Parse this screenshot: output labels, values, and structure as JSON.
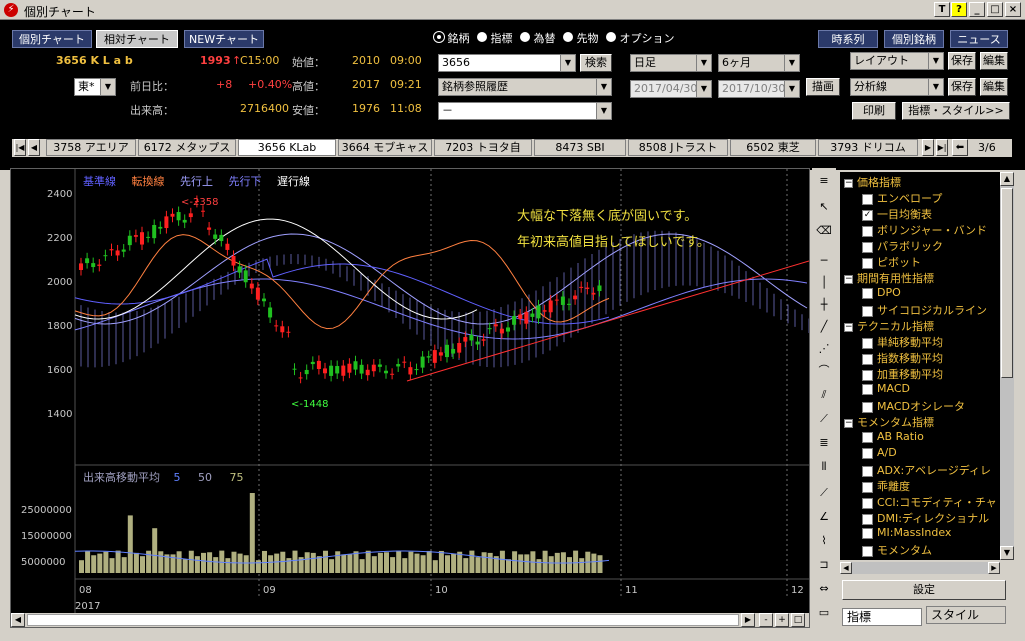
{
  "window": {
    "title": "個別チャート"
  },
  "toolbar": {
    "views": [
      "個別チャート",
      "相対チャート",
      "NEWチャート"
    ],
    "right_buttons": [
      "時系列",
      "個別銘柄",
      "ニュース"
    ],
    "asset_types": [
      "銘柄",
      "指標",
      "為替",
      "先物",
      "オプション"
    ]
  },
  "quote": {
    "symbol": "3656 K L a b",
    "price": "1993",
    "arrow": "↑",
    "price_time": "C15:00",
    "exchange": "東*",
    "change_label": "前日比：",
    "change": "+8",
    "change_pct": "+0.40%",
    "volume_label": "出来高：",
    "volume": "2716400",
    "open_label": "始値：",
    "open": "2010",
    "open_time": "09:00",
    "high_label": "高値：",
    "high": "2017",
    "high_time": "09:21",
    "low_label": "安値：",
    "low": "1976",
    "low_time": "11:08"
  },
  "search": {
    "code": "3656",
    "search_btn": "検索",
    "history": "銘柄参照履歴",
    "blank": "－"
  },
  "period": {
    "interval": "日足",
    "range": "6ヶ月",
    "date_from": "2017/04/30",
    "date_to": "2017/10/30",
    "draw_btn": "描画"
  },
  "layout": {
    "layout": "レイアウト",
    "save": "保存",
    "edit": "編集",
    "analysis": "分析線",
    "print": "印刷",
    "style_btn": "指標・スタイル>>"
  },
  "tabs": {
    "items": [
      "3758 アエリア",
      "6172 メタップス",
      "3656 KLab",
      "3664 モブキャス",
      "7203 トヨタ自",
      "8473 SBI",
      "8508 Jトラスト",
      "6502 東芝",
      "3793 ドリコム"
    ],
    "selected": 2,
    "page": "3/6"
  },
  "chart": {
    "legend": [
      "基準線",
      "転換線",
      "先行上",
      "先行下",
      "遅行線"
    ],
    "legend_colors": [
      "#6060ff",
      "#ff8040",
      "#a0a0ff",
      "#8080ff",
      "#ffffff"
    ],
    "annotation_line1": "大幅な下落無く底が固いです。",
    "annotation_line2": "年初来高値目指してほしいです。",
    "high_mark": "<-2358",
    "low_mark": "<-1448",
    "y_ticks": [
      "2400",
      "2200",
      "2000",
      "1800",
      "1600",
      "1400"
    ],
    "vol_legend": "出来高移動平均",
    "vol_periods": [
      "5",
      "50",
      "75"
    ],
    "vol_ticks": [
      "25000000",
      "15000000",
      "5000000"
    ],
    "x_ticks": [
      "08",
      "09",
      "10",
      "11",
      "12"
    ],
    "year": "2017"
  },
  "indicators": {
    "groups": [
      {
        "name": "価格指標",
        "items": [
          {
            "label": "エンベロープ",
            "checked": false
          },
          {
            "label": "一目均衡表",
            "checked": true
          },
          {
            "label": "ボリンジャー・バンド",
            "checked": false
          },
          {
            "label": "パラボリック",
            "checked": false
          },
          {
            "label": "ピボット",
            "checked": false
          }
        ]
      },
      {
        "name": "期間有用性指標",
        "items": [
          {
            "label": "DPO",
            "checked": false
          },
          {
            "label": "サイコロジカルライン",
            "checked": false
          }
        ]
      },
      {
        "name": "テクニカル指標",
        "items": [
          {
            "label": "単純移動平均",
            "checked": false
          },
          {
            "label": "指数移動平均",
            "checked": false
          },
          {
            "label": "加重移動平均",
            "checked": false
          },
          {
            "label": "MACD",
            "checked": false
          },
          {
            "label": "MACDオシレータ",
            "checked": false
          }
        ]
      },
      {
        "name": "モメンタム指標",
        "items": [
          {
            "label": "AB Ratio",
            "checked": false
          },
          {
            "label": "A/D",
            "checked": false
          },
          {
            "label": "ADX:アベレージディレ",
            "checked": false
          },
          {
            "label": "乖離度",
            "checked": false
          },
          {
            "label": "CCI:コモディティ・チャ",
            "checked": false
          },
          {
            "label": "DMI:ディレクショナル",
            "checked": false
          },
          {
            "label": "MI:MassIndex",
            "checked": false
          },
          {
            "label": "モメンタム",
            "checked": false
          }
        ]
      }
    ],
    "settings_btn": "設定",
    "tab_indicator": "指標",
    "tab_style": "スタイル"
  }
}
